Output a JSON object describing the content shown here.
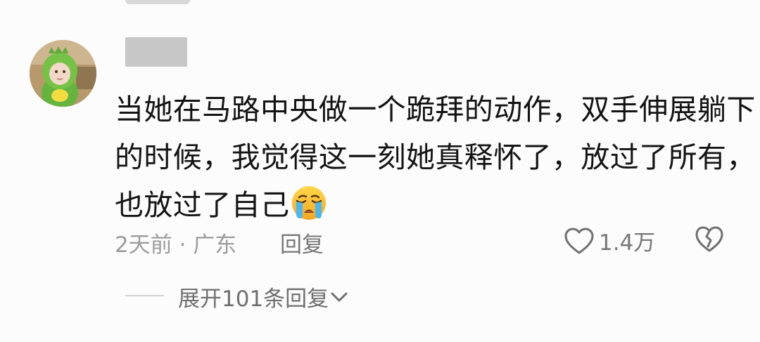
{
  "comment": {
    "lines": [
      "当她在马路中央做一个跪拜的动作，双手伸展躺下",
      "的时候，我觉得这一刻她真释怀了，放过了所有，",
      "也放过了自己"
    ],
    "emoji_icon": "crying-face-icon"
  },
  "meta": {
    "time_location": "2天前 · 广东",
    "reply_label": "回复"
  },
  "actions": {
    "like_icon": "heart-outline-icon",
    "like_count": "1.4万",
    "dislike_icon": "broken-heart-icon"
  },
  "replies": {
    "expand_label": "展开101条回复",
    "expand_icon": "chevron-down-icon"
  },
  "colors": {
    "background": "#fcfcfc",
    "text": "#141414",
    "secondary_text": "#777777",
    "muted_text": "#9c9c9c",
    "redacted_username": "#c7c7c7"
  }
}
